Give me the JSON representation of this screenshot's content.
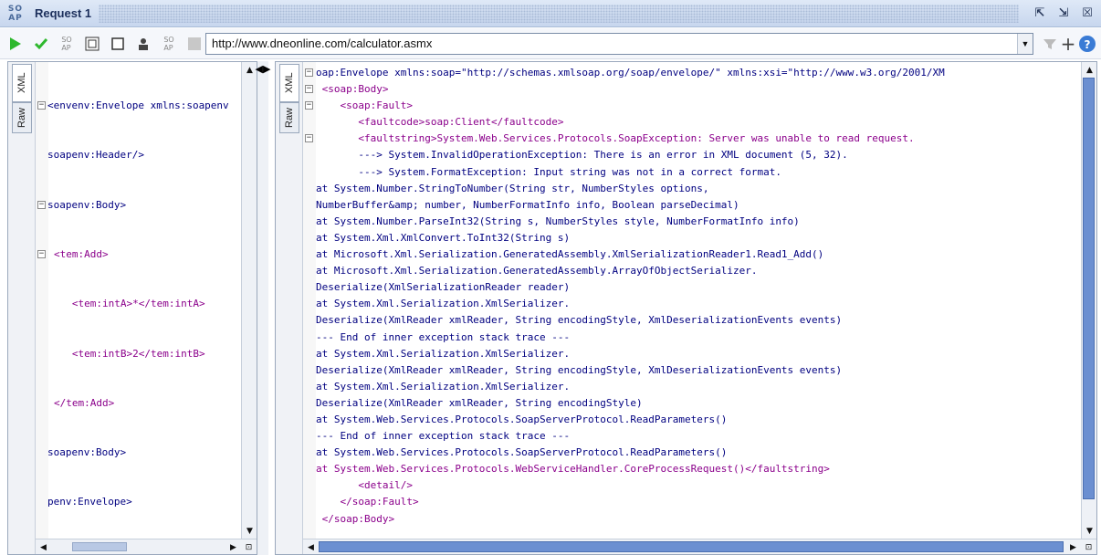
{
  "window": {
    "logo_top": "SO",
    "logo_bottom": "AP",
    "title": "Request 1",
    "btn_detach": "⇱",
    "btn_tile": "⇲",
    "btn_close": "☒"
  },
  "toolbar": {
    "url": "http://www.dneonline.com/calculator.asmx",
    "icons": [
      "run-icon",
      "check-icon",
      "soap-icon",
      "wsdl-icon",
      "square-icon",
      "person-icon",
      "soap-icon",
      "stop-icon"
    ],
    "right_icons": [
      "filter-icon",
      "plus-icon",
      "help-icon"
    ]
  },
  "request_panel": {
    "tab_xml": "XML",
    "tab_raw": "Raw",
    "lines": [
      "<envenv:Envelope xmlns:soapenv",
      "soapenv:Header/>",
      "soapenv:Body>",
      "<tem:Add>",
      "   <tem:intA>*</tem:intA>",
      "   <tem:intB>2</tem:intB>",
      "</tem:Add>",
      "soapenv:Body>",
      "penv:Envelope>"
    ]
  },
  "response_panel": {
    "tab_xml": "XML",
    "tab_raw": "Raw",
    "lines": [
      "oap:Envelope xmlns:soap=\"http://schemas.xmlsoap.org/soap/envelope/\" xmlns:xsi=\"http://www.w3.org/2001/XM",
      " <soap:Body>",
      "    <soap:Fault>",
      "       <faultcode>soap:Client</faultcode>",
      "       <faultstring>System.Web.Services.Protocols.SoapException: Server was unable to read request.",
      "       ---> System.InvalidOperationException: There is an error in XML document (5, 32).",
      "       ---> System.FormatException: Input string was not in a correct format.",
      "at System.Number.StringToNumber(String str, NumberStyles options,",
      "NumberBuffer&amp; number, NumberFormatInfo info, Boolean parseDecimal)",
      "at System.Number.ParseInt32(String s, NumberStyles style, NumberFormatInfo info)",
      "at System.Xml.XmlConvert.ToInt32(String s)",
      "at Microsoft.Xml.Serialization.GeneratedAssembly.XmlSerializationReader1.Read1_Add()",
      "at Microsoft.Xml.Serialization.GeneratedAssembly.ArrayOfObjectSerializer.",
      "Deserialize(XmlSerializationReader reader)",
      "at System.Xml.Serialization.XmlSerializer.",
      "Deserialize(XmlReader xmlReader, String encodingStyle, XmlDeserializationEvents events)",
      "--- End of inner exception stack trace ---",
      "at System.Xml.Serialization.XmlSerializer.",
      "Deserialize(XmlReader xmlReader, String encodingStyle, XmlDeserializationEvents events)",
      "at System.Xml.Serialization.XmlSerializer.",
      "Deserialize(XmlReader xmlReader, String encodingStyle)",
      "at System.Web.Services.Protocols.SoapServerProtocol.ReadParameters()",
      "--- End of inner exception stack trace ---",
      "at System.Web.Services.Protocols.SoapServerProtocol.ReadParameters()",
      "at System.Web.Services.Protocols.WebServiceHandler.CoreProcessRequest()</faultstring>",
      "       <detail/>",
      "    </soap:Fault>",
      " </soap:Body>"
    ]
  },
  "colors": {
    "tag": "#8b008b",
    "text": "#000080",
    "scroll_thumb": "#6b8fd1"
  }
}
